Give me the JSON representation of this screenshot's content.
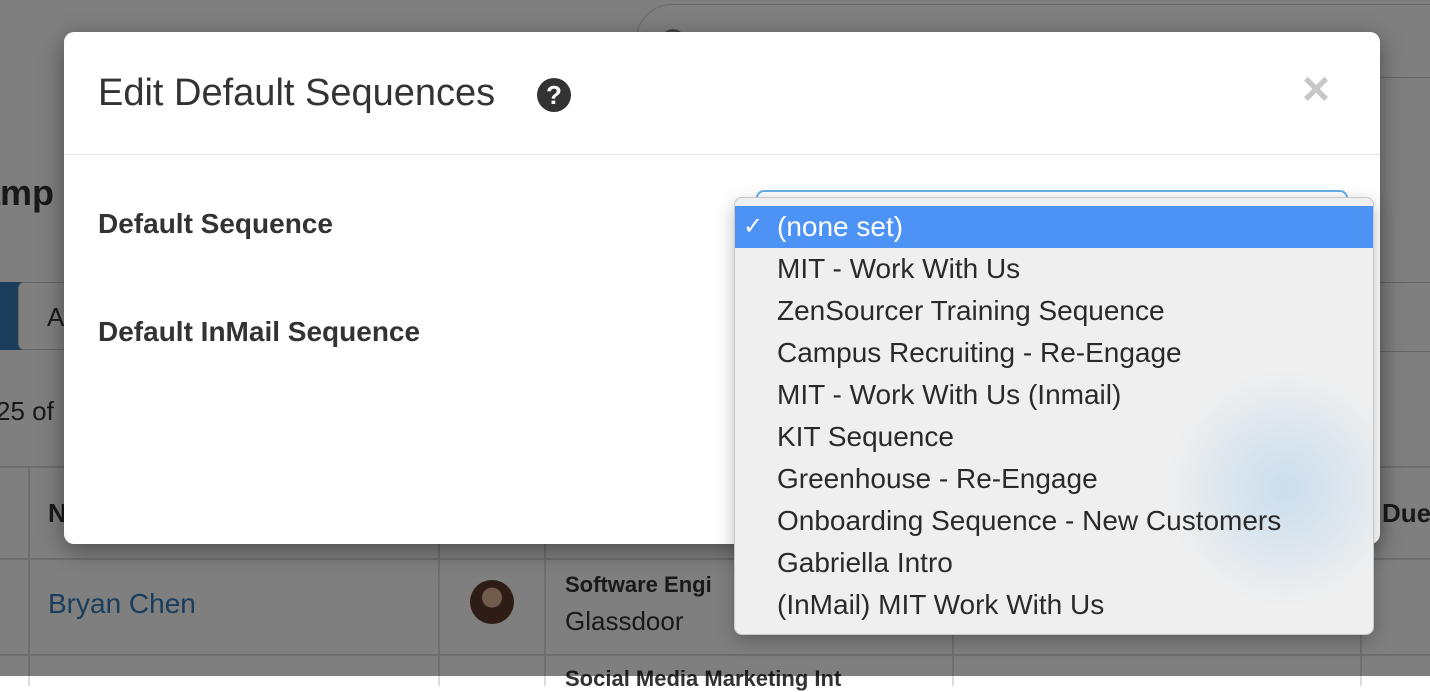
{
  "background": {
    "heading_fragment": "amp",
    "button_fragment": "A",
    "count_fragment": "25 of",
    "table": {
      "col_n": "N",
      "col_due": "Due",
      "rows": [
        {
          "name": "Bryan Chen",
          "job": "Software Engi",
          "company": "Glassdoor"
        },
        {
          "job": "Social Media Marketing Int"
        }
      ]
    }
  },
  "modal": {
    "title": "Edit Default Sequences",
    "help_icon": "question-circle-icon",
    "close_symbol": "×",
    "fields": [
      {
        "label": "Default Sequence"
      },
      {
        "label": "Default InMail Sequence"
      }
    ]
  },
  "dropdown": {
    "check_symbol": "✓",
    "selected_index": 0,
    "options": [
      "(none set)",
      "MIT - Work With Us",
      "ZenSourcer Training Sequence",
      "Campus Recruiting - Re-Engage",
      "MIT - Work With Us (Inmail)",
      "KIT Sequence",
      "Greenhouse - Re-Engage",
      "Onboarding Sequence - New Customers",
      "Gabriella Intro",
      "(InMail) MIT Work With Us"
    ]
  },
  "colors": {
    "selected_bg": "#4d93f6",
    "link": "#337ab7",
    "overlay": "rgba(0,0,0,0.5)"
  }
}
